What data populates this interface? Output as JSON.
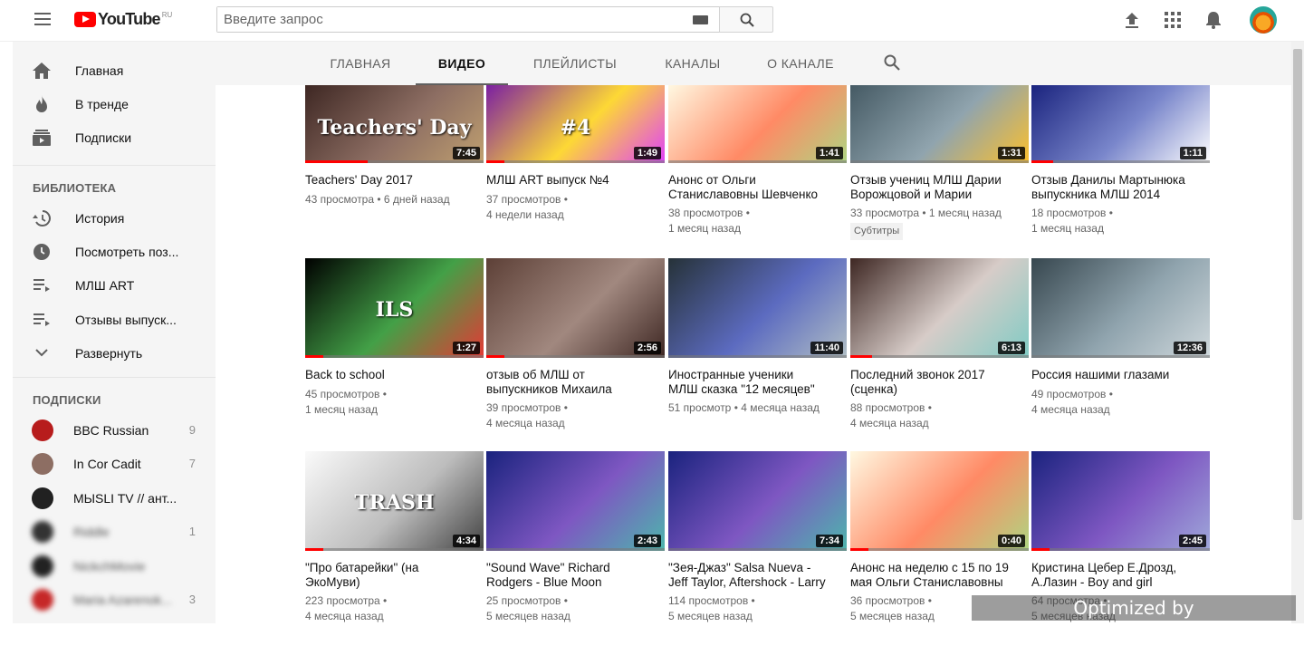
{
  "header": {
    "logo_text": "YouTube",
    "logo_region": "RU",
    "search_placeholder": "Введите запрос"
  },
  "sidebar": {
    "main_items": [
      {
        "label": "Главная",
        "icon": "home-icon"
      },
      {
        "label": "В тренде",
        "icon": "flame-icon"
      },
      {
        "label": "Подписки",
        "icon": "subscriptions-icon"
      }
    ],
    "library_heading": "БИБЛИОТЕКА",
    "library_items": [
      {
        "label": "История",
        "icon": "history-icon"
      },
      {
        "label": "Посмотреть поз...",
        "icon": "clock-icon"
      },
      {
        "label": "МЛШ ART",
        "icon": "playlist-icon"
      },
      {
        "label": "Отзывы выпуск...",
        "icon": "playlist-icon"
      },
      {
        "label": "Развернуть",
        "icon": "chevron-down-icon"
      }
    ],
    "subs_heading": "ПОДПИСКИ",
    "subscriptions": [
      {
        "name": "BBC Russian",
        "count": "9",
        "color": "#b71c1c"
      },
      {
        "name": "In Cor Cadit",
        "count": "7",
        "color": "#8d6e63"
      },
      {
        "name": "MЫSLI TV // ант...",
        "count": "",
        "color": "#212121"
      },
      {
        "name": "Riddle",
        "count": "1",
        "color": "#333333"
      },
      {
        "name": "NickchMovie",
        "count": "",
        "color": "#222222"
      },
      {
        "name": "Maria Azarenok...",
        "count": "3",
        "color": "#c62828"
      }
    ]
  },
  "tabs": [
    "ГЛАВНАЯ",
    "ВИДЕО",
    "ПЛЕЙЛИСТЫ",
    "КАНАЛЫ",
    "О КАНАЛЕ"
  ],
  "videos": [
    {
      "title1": "Teachers' Day 2017",
      "title2": "",
      "meta1": "43 просмотра • 6 дней назад",
      "meta2": "",
      "badge": "",
      "duration": "7:45",
      "progress": 0.35,
      "colors": [
        "#3e2723",
        "#8d6e63",
        "#c0a070"
      ],
      "overlay": "Teachers' Day"
    },
    {
      "title1": "МЛШ ART выпуск №4",
      "title2": "",
      "meta1": "37 просмотров •",
      "meta2": "4 недели назад",
      "badge": "",
      "duration": "1:49",
      "progress": 0.1,
      "colors": [
        "#7b1fa2",
        "#fdd835",
        "#e040fb"
      ],
      "overlay": "#4"
    },
    {
      "title1": "Анонс от Ольги",
      "title2": "Станиславовны Шевченко",
      "meta1": "38 просмотров •",
      "meta2": "1 месяц назад",
      "badge": "",
      "duration": "1:41",
      "progress": 0.0,
      "colors": [
        "#fff8e1",
        "#ff8a65",
        "#aed581"
      ],
      "overlay": ""
    },
    {
      "title1": "Отзыв учениц МЛШ Дарии",
      "title2": "Ворожцовой и Марии",
      "meta1": "33 просмотра • 1 месяц назад",
      "meta2": "",
      "badge": "Субтитры",
      "duration": "1:31",
      "progress": 0.0,
      "colors": [
        "#455a64",
        "#90a4ae",
        "#fbc02d"
      ],
      "overlay": ""
    },
    {
      "title1": "Отзыв Данилы Мартынюка",
      "title2": "выпускника МЛШ 2014",
      "meta1": "18 просмотров •",
      "meta2": "1 месяц назад",
      "badge": "",
      "duration": "1:11",
      "progress": 0.12,
      "colors": [
        "#1a237e",
        "#7986cb",
        "#ffffff"
      ],
      "overlay": ""
    },
    {
      "title1": "Back to school",
      "title2": "",
      "meta1": "45 просмотров •",
      "meta2": "1 месяц назад",
      "badge": "",
      "duration": "1:27",
      "progress": 0.1,
      "colors": [
        "#000000",
        "#43a047",
        "#e53935"
      ],
      "overlay": "ILS"
    },
    {
      "title1": "отзыв об МЛШ от",
      "title2": "выпускников Михаила",
      "meta1": "39 просмотров •",
      "meta2": "4 месяца назад",
      "badge": "",
      "duration": "2:56",
      "progress": 0.1,
      "colors": [
        "#5d4037",
        "#a1887f",
        "#3e2723"
      ],
      "overlay": ""
    },
    {
      "title1": "Иностранные ученики",
      "title2": "МЛШ сказка \"12 месяцев\"",
      "meta1": "51 просмотр • 4 месяца назад",
      "meta2": "",
      "badge": "",
      "duration": "11:40",
      "progress": 0.0,
      "colors": [
        "#263238",
        "#5c6bc0",
        "#b0bec5"
      ],
      "overlay": ""
    },
    {
      "title1": "Последний звонок 2017",
      "title2": "(сценка)",
      "meta1": "88 просмотров •",
      "meta2": "4 месяца назад",
      "badge": "",
      "duration": "6:13",
      "progress": 0.12,
      "colors": [
        "#3e2723",
        "#d7ccc8",
        "#80cbc4"
      ],
      "overlay": ""
    },
    {
      "title1": "Россия нашими глазами",
      "title2": "",
      "meta1": "49 просмотров •",
      "meta2": "4 месяца назад",
      "badge": "",
      "duration": "12:36",
      "progress": 0.0,
      "colors": [
        "#37474f",
        "#90a4ae",
        "#cfd8dc"
      ],
      "overlay": ""
    },
    {
      "title1": "\"Про батарейки\" (на",
      "title2": "ЭкоМуви)",
      "meta1": "223 просмотра •",
      "meta2": "4 месяца назад",
      "badge": "",
      "duration": "4:34",
      "progress": 0.1,
      "colors": [
        "#fafafa",
        "#bdbdbd",
        "#424242"
      ],
      "overlay": "TRASH"
    },
    {
      "title1": "\"Sound Wave\" Richard",
      "title2": "Rodgers - Blue Moon",
      "meta1": "25 просмотров •",
      "meta2": "5 месяцев назад",
      "badge": "",
      "duration": "2:43",
      "progress": 0.0,
      "colors": [
        "#1a237e",
        "#7e57c2",
        "#4db6ac"
      ],
      "overlay": ""
    },
    {
      "title1": "\"Зея-Джаз\" Salsa Nueva -",
      "title2": "Jeff Taylor, Aftershock - Larry",
      "meta1": "114 просмотров •",
      "meta2": "5 месяцев назад",
      "badge": "",
      "duration": "7:34",
      "progress": 0.0,
      "colors": [
        "#1a237e",
        "#7e57c2",
        "#4db6ac"
      ],
      "overlay": ""
    },
    {
      "title1": "Анонс на неделю с 15 по 19",
      "title2": "мая Ольги Станиславовны",
      "meta1": "36 просмотров •",
      "meta2": "5 месяцев назад",
      "badge": "",
      "duration": "0:40",
      "progress": 0.1,
      "colors": [
        "#fff8e1",
        "#ff8a65",
        "#aed581"
      ],
      "overlay": ""
    },
    {
      "title1": "Кристина Цебер Е.Дрозд,",
      "title2": "А.Лазин - Boy and girl",
      "meta1": "64 просмотра •",
      "meta2": "5 месяцев назад",
      "badge": "",
      "duration": "2:45",
      "progress": 0.1,
      "colors": [
        "#1a237e",
        "#7e57c2",
        "#9fa8da"
      ],
      "overlay": ""
    }
  ],
  "watermark": "Optimized by www.ImageOptimizer.net"
}
